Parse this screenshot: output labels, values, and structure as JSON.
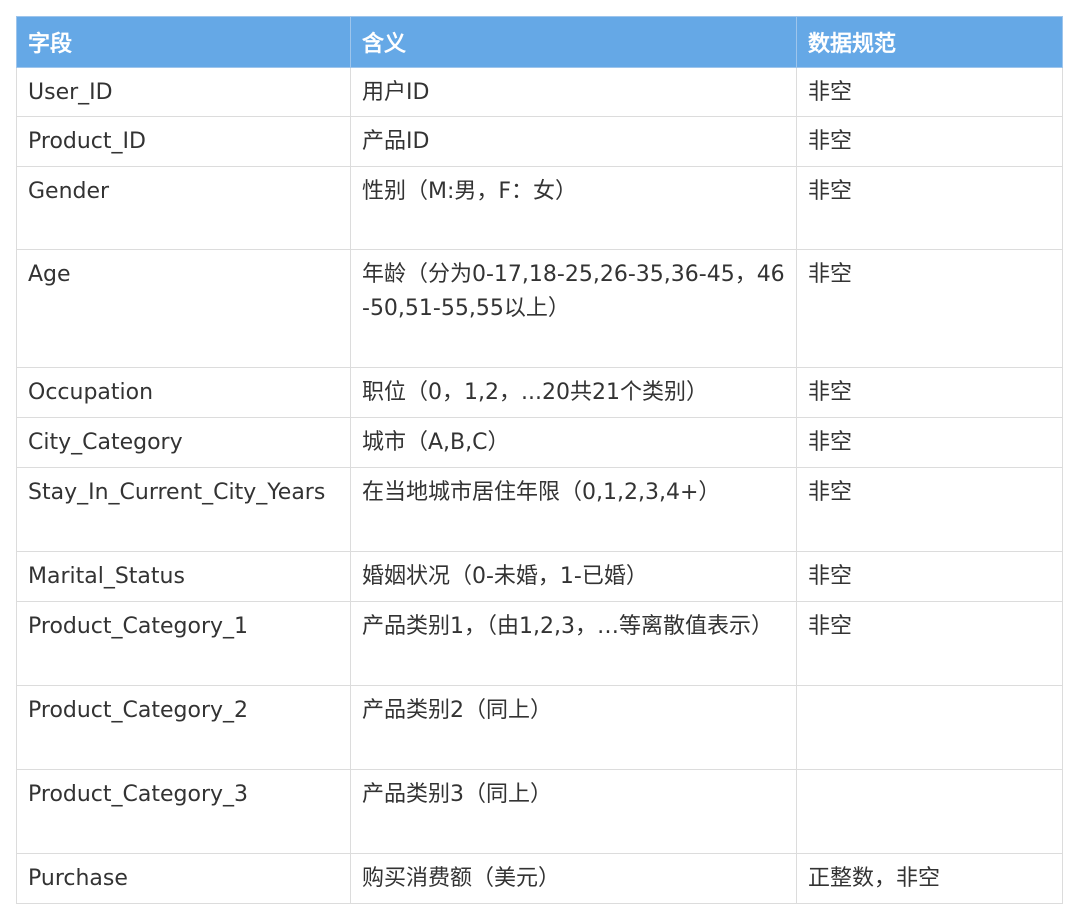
{
  "table": {
    "headers": [
      "字段",
      "含义",
      "数据规范"
    ],
    "rows": [
      {
        "field": "User_ID",
        "meaning": "用户ID",
        "spec": "非空"
      },
      {
        "field": "Product_ID",
        "meaning": "产品ID",
        "spec": "非空"
      },
      {
        "field": "Gender",
        "meaning": "性别（M:男，F：女）",
        "spec": "非空"
      },
      {
        "field": "Age",
        "meaning": "年龄（分为0-17,18-25,26-35,36-45，46-50,51-55,55以上）",
        "spec": "非空"
      },
      {
        "field": "Occupation",
        "meaning": "职位（0，1,2，...20共21个类别）",
        "spec": "非空"
      },
      {
        "field": "City_Category",
        "meaning": "城市（A,B,C）",
        "spec": "非空"
      },
      {
        "field": "Stay_In_Current_City_Years",
        "meaning": "在当地城市居住年限（0,1,2,3,4+）",
        "spec": "非空"
      },
      {
        "field": "Marital_Status",
        "meaning": "婚姻状况（0-未婚，1-已婚）",
        "spec": "非空"
      },
      {
        "field": "Product_Category_1",
        "meaning": "产品类别1，（由1,2,3，…等离散值表示）",
        "spec": "非空"
      },
      {
        "field": "Product_Category_2",
        "meaning": "产品类别2（同上）",
        "spec": ""
      },
      {
        "field": "Product_Category_3",
        "meaning": "产品类别3（同上）",
        "spec": ""
      },
      {
        "field": "Purchase",
        "meaning": "购买消费额（美元）",
        "spec": "正整数，非空"
      }
    ]
  }
}
